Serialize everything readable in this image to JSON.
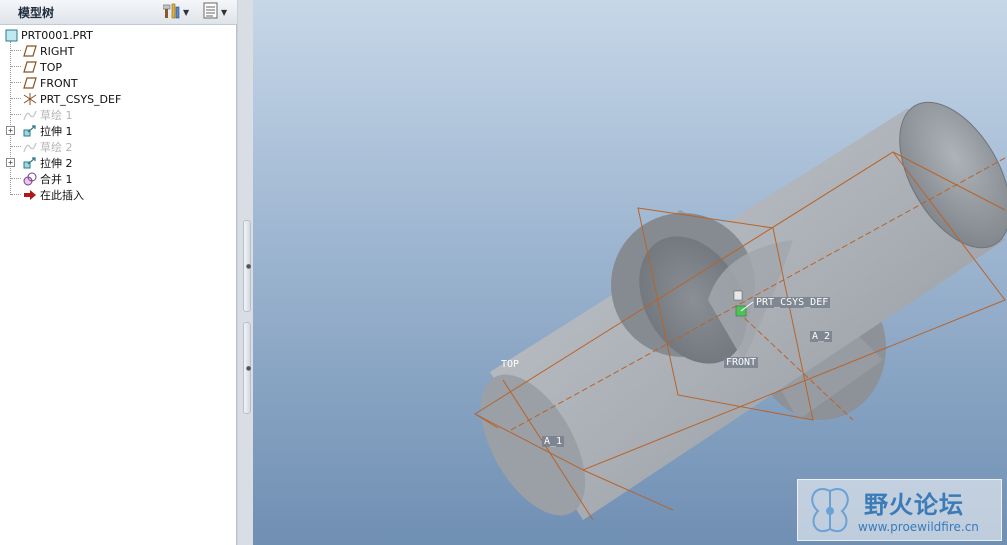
{
  "tree": {
    "title": "模型树",
    "header_buttons": [
      {
        "icon": "settings-tools-icon"
      },
      {
        "icon": "show-list-icon"
      }
    ],
    "items": [
      {
        "label": "PRT0001.PRT",
        "icon": "part-icon",
        "dim": false
      },
      {
        "label": "RIGHT",
        "icon": "datum-plane-icon",
        "dim": false
      },
      {
        "label": "TOP",
        "icon": "datum-plane-icon",
        "dim": false
      },
      {
        "label": "FRONT",
        "icon": "datum-plane-icon",
        "dim": false
      },
      {
        "label": "PRT_CSYS_DEF",
        "icon": "coordinate-system-icon",
        "dim": false
      },
      {
        "label": "草绘 1",
        "icon": "sketch-icon",
        "dim": true
      },
      {
        "label": "拉伸 1",
        "icon": "extrude-icon",
        "dim": false
      },
      {
        "label": "草绘 2",
        "icon": "sketch-icon",
        "dim": true
      },
      {
        "label": "拉伸 2",
        "icon": "extrude-icon",
        "dim": false
      },
      {
        "label": "合并 1",
        "icon": "merge-icon",
        "dim": false
      },
      {
        "label": "在此插入",
        "icon": "insert-here-arrow-icon",
        "dim": false
      }
    ]
  },
  "viewport": {
    "labels": {
      "top": "TOP",
      "front": "FRONT",
      "csys": "PRT_CSYS_DEF",
      "axis1": "A_1",
      "axis2": "A_2"
    }
  },
  "watermark": {
    "title": "野火论坛",
    "url": "www.proewildfire.cn"
  },
  "colors": {
    "viewport_top": "#c6d7e8",
    "viewport_bottom": "#6f8fb3",
    "datum_line": "#b8632a",
    "solid_fill": "#a7adb4"
  }
}
